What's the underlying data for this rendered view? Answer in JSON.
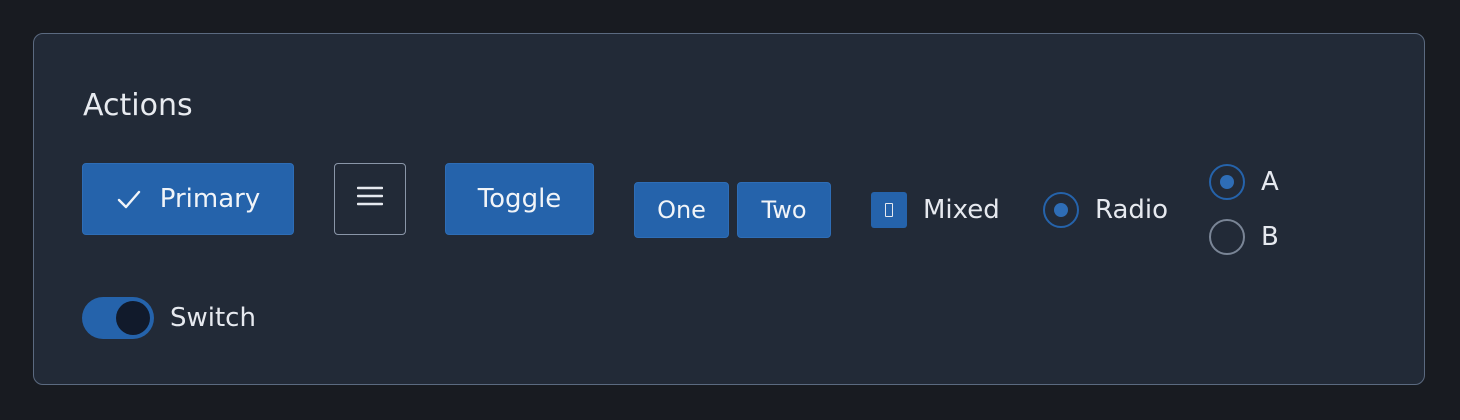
{
  "panel": {
    "heading": "Actions"
  },
  "buttons": {
    "primary_label": "Primary",
    "primary_icon": "check-icon",
    "menu_icon": "hamburger-menu-icon",
    "toggle_label": "Toggle"
  },
  "segmented": {
    "items": [
      {
        "label": "One"
      },
      {
        "label": "Two"
      }
    ]
  },
  "checkbox": {
    "label": "Mixed",
    "state": "mixed"
  },
  "radio": {
    "label": "Radio",
    "checked": true
  },
  "radio_group": {
    "options": [
      {
        "label": "A",
        "checked": true
      },
      {
        "label": "B",
        "checked": false
      }
    ]
  },
  "switch": {
    "label": "Switch",
    "on": true
  },
  "colors": {
    "accent": "#2563ab",
    "panel_bg": "#222a37",
    "page_bg": "#181b21",
    "border": "#5b6a80",
    "text": "#e6e9ef"
  }
}
